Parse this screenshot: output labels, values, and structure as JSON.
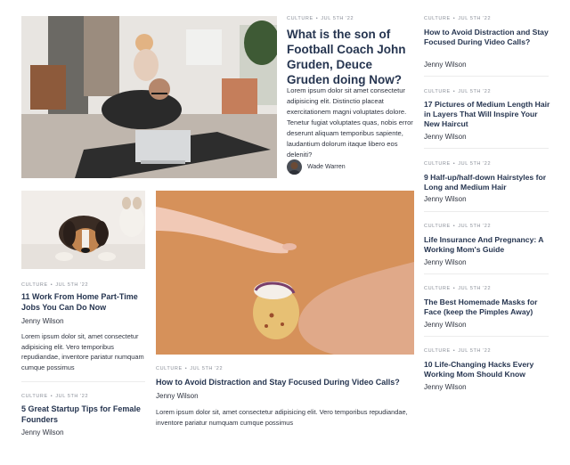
{
  "featured": {
    "category": "CULTURE",
    "date": "JUL 5TH '22",
    "title": "What is the son of Football Coach John Gruden, Deuce Gruden doing Now?",
    "excerpt": "Lorem ipsum dolor sit amet consectetur adipisicing elit. Distinctio placeat exercitationem magni voluptates dolore. Tenetur fugiat voluptates quas, nobis error deserunt aliquam temporibus sapiente, laudantium dolorum itaque libero eos deleniti?",
    "author": "Wade Warren"
  },
  "left_col": [
    {
      "category": "CULTURE",
      "date": "JUL 5TH '22",
      "title": "11 Work From Home Part-Time Jobs You Can Do Now",
      "author": "Jenny Wilson",
      "excerpt": "Lorem ipsum dolor sit, amet consectetur adipisicing elit. Vero temporibus repudiandae, inventore pariatur numquam cumque possimus"
    },
    {
      "category": "CULTURE",
      "date": "JUL 5TH '22",
      "title": "5 Great Startup Tips for Female Founders",
      "author": "Jenny Wilson"
    }
  ],
  "center_post": {
    "category": "CULTURE",
    "date": "JUL 5TH '22",
    "title": "How to Avoid Distraction and Stay Focused During Video Calls?",
    "author": "Jenny Wilson",
    "excerpt": "Lorem ipsum dolor sit, amet consectetur adipisicing elit. Vero temporibus repudiandae, inventore pariatur numquam cumque possimus"
  },
  "sidebar": [
    {
      "category": "CULTURE",
      "date": "JUL 5TH '22",
      "title": "How to Avoid Distraction and Stay Focused During Video Calls?",
      "author": "Jenny Wilson"
    },
    {
      "category": "CULTURE",
      "date": "JUL 5TH '22",
      "title": "17 Pictures of Medium Length Hair in Layers That Will Inspire Your New Haircut",
      "author": "Jenny Wilson"
    },
    {
      "category": "CULTURE",
      "date": "JUL 5TH '22",
      "title": "9 Half-up/half-down Hairstyles for Long and Medium Hair",
      "author": "Jenny Wilson"
    },
    {
      "category": "CULTURE",
      "date": "JUL 5TH '22",
      "title": "Life Insurance And Pregnancy: A Working Mom's Guide",
      "author": "Jenny Wilson"
    },
    {
      "category": "CULTURE",
      "date": "JUL 5TH '22",
      "title": "The Best Homemade Masks for Face (keep the Pimples Away)",
      "author": "Jenny Wilson"
    },
    {
      "category": "CULTURE",
      "date": "JUL 5TH '22",
      "title": "10 Life-Changing Hacks Every Working Mom Should Know",
      "author": "Jenny Wilson"
    }
  ],
  "colors": {
    "title": "#263550",
    "meta": "#8a8f99",
    "orange_bg": "#d6915a"
  }
}
